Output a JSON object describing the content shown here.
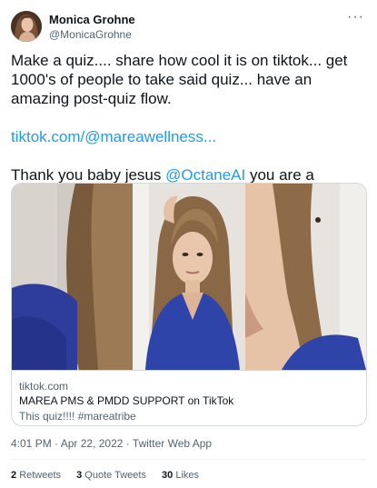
{
  "author": {
    "name": "Monica Grohne",
    "handle": "@MonicaGrohne"
  },
  "more_icon": "more-dots-icon",
  "tweet": {
    "line1": "Make a quiz.... share how cool it is on tiktok... get 1000's of people to take said quiz... have an amazing post-quiz flow.",
    "link": "tiktok.com/@mareawellness...",
    "line3_prefix": "Thank you baby jesus ",
    "mention": "@OctaneAI",
    "line3_suffix": " you are a godsend."
  },
  "card": {
    "domain": "tiktok.com",
    "title": "MAREA PMS & PMDD SUPPORT on TikTok",
    "description": "This quiz!!!! #mareatribe"
  },
  "meta": {
    "time": "4:01 PM",
    "date": "Apr 22, 2022",
    "separator": "·",
    "source": "Twitter Web App"
  },
  "stats": {
    "retweets_count": "2",
    "retweets_label": "Retweets",
    "quotes_count": "3",
    "quotes_label": "Quote Tweets",
    "likes_count": "30",
    "likes_label": "Likes"
  },
  "colors": {
    "link": "#1d9bf0",
    "muted": "#536471",
    "text": "#0f1419",
    "border": "#cfd9de"
  }
}
